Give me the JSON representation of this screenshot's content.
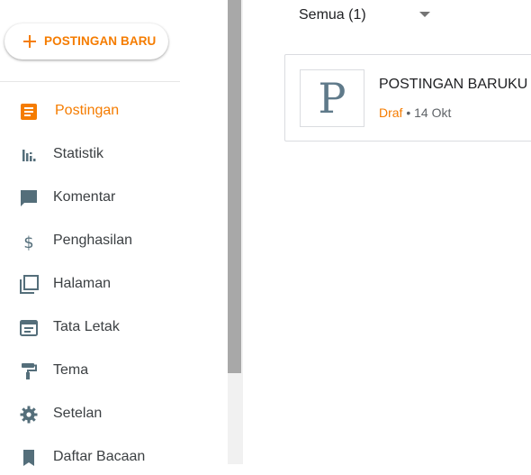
{
  "sidebar": {
    "new_post_label": "POSTINGAN BARU",
    "items": [
      {
        "label": "Postingan",
        "icon": "posts-icon",
        "active": true
      },
      {
        "label": "Statistik",
        "icon": "stats-icon"
      },
      {
        "label": "Komentar",
        "icon": "comment-icon"
      },
      {
        "label": "Penghasilan",
        "icon": "dollar-icon"
      },
      {
        "label": "Halaman",
        "icon": "pages-icon"
      },
      {
        "label": "Tata Letak",
        "icon": "layout-icon"
      },
      {
        "label": "Tema",
        "icon": "paint-roller-icon"
      },
      {
        "label": "Setelan",
        "icon": "gear-icon"
      },
      {
        "label": "Daftar Bacaan",
        "icon": "bookmark-icon"
      }
    ]
  },
  "main": {
    "filter_value": "Semua (1)",
    "posts": [
      {
        "thumbnail_letter": "P",
        "title": "POSTINGAN BARUKU",
        "status": "Draf",
        "separator": "•",
        "date": "14 Okt"
      }
    ]
  },
  "colors": {
    "accent": "#f57c00",
    "icon": "#546e7a",
    "text": "#3c4043"
  }
}
